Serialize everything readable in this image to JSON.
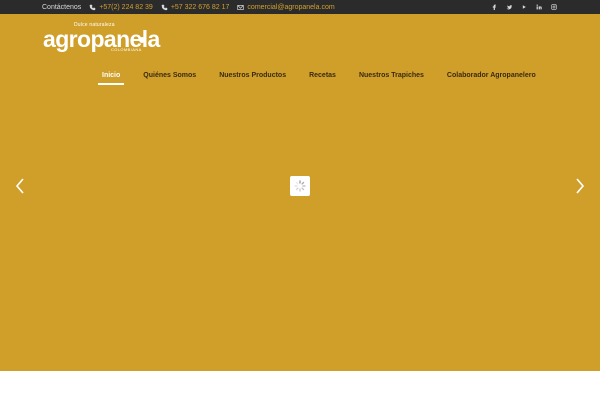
{
  "topbar": {
    "contact_label": "Contáctenos",
    "phone_1": "+57(2) 224 82 39",
    "phone_2": "+57 322 676 82 17",
    "email": "comercial@agropanela.com",
    "social_icons": [
      "facebook-icon",
      "twitter-icon",
      "youtube-icon",
      "linkedin-icon",
      "instagram-icon"
    ]
  },
  "logo": {
    "tagline": "Dulce naturaleza",
    "wordmark": "agropanela",
    "subtitle": "COLOMBIANA"
  },
  "nav": {
    "items": [
      {
        "label": "Inicio",
        "active": true
      },
      {
        "label": "Quiénes Somos",
        "active": false
      },
      {
        "label": "Nuestros Productos",
        "active": false
      },
      {
        "label": "Recetas",
        "active": false
      },
      {
        "label": "Nuestros Trapiches",
        "active": false
      },
      {
        "label": "Colaborador Agropanelero",
        "active": false
      }
    ]
  },
  "slider": {
    "prev_icon": "chevron-left-icon",
    "next_icon": "chevron-right-icon",
    "loader_icon": "spinner-icon"
  },
  "colors": {
    "brand": "#cf9f2a",
    "topbar": "#2b2b2b",
    "accent_text": "#d2a12e"
  }
}
